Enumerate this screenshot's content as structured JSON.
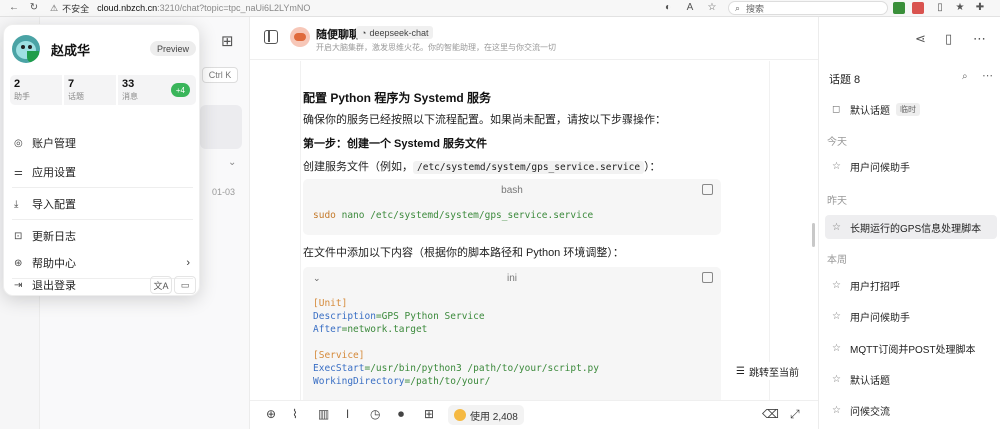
{
  "browser": {
    "insecure_label": "不安全",
    "url_host": "cloud.nbzch.cn",
    "url_path": ":3210/chat?topic=tpc_naUi6L2LYmNO",
    "search_placeholder": "搜索"
  },
  "sessions": {
    "shortcut": "Ctrl K",
    "date": "01-03"
  },
  "profile": {
    "name": "赵成华",
    "badge": "Preview",
    "stats": [
      {
        "num": "2",
        "label": "助手"
      },
      {
        "num": "7",
        "label": "话题"
      },
      {
        "num": "33",
        "label": "消息"
      }
    ],
    "plus": "+4",
    "menu": [
      {
        "label": "账户管理",
        "icon": "user-circle-icon"
      },
      {
        "label": "应用设置",
        "icon": "sliders-icon"
      },
      {
        "label": "导入配置",
        "icon": "import-icon"
      },
      {
        "label": "更新日志",
        "icon": "changelog-icon"
      },
      {
        "label": "帮助中心",
        "icon": "help-icon"
      },
      {
        "label": "退出登录",
        "icon": "logout-icon"
      }
    ]
  },
  "chat": {
    "title": "随便聊聊",
    "model": "deepseek-chat",
    "description": "开启大脑集群，激发思维火花。你的智能助理，在这里与你交流一切",
    "heading": "配置 Python 程序为 Systemd 服务",
    "intro": "确保你的服务已经按照以下流程配置。如果尚未配置，请按以下步骤操作：",
    "step1": "第一步：创建一个 Systemd 服务文件",
    "create_text_prefix": "创建服务文件（例如，",
    "create_path": "/etc/systemd/system/gps_service.service",
    "create_text_suffix": "）：",
    "code1_lang": "bash",
    "code1_cmd": "sudo",
    "code1_rest": " nano /etc/systemd/system/gps_service.service",
    "add_text": "在文件中添加以下内容（根据你的脚本路径和 Python 环境调整）：",
    "code2_lang": "ini",
    "code2_lines": [
      {
        "sec": "[Unit]"
      },
      {
        "key": "Description",
        "val": "=GPS Python Service"
      },
      {
        "key": "After",
        "val": "=network.target"
      },
      {
        "blank": ""
      },
      {
        "sec": "[Service]"
      },
      {
        "key": "ExecStart",
        "val": "=/usr/bin/python3 /path/to/your/script.py"
      },
      {
        "key": "WorkingDirectory",
        "val": "=/path/to/your/"
      }
    ],
    "jump_label": "跳转至当前",
    "usage": "使用 2,408"
  },
  "topics": {
    "title": "话题 8",
    "default_topic": "默认话题",
    "temp_badge": "临时",
    "groups": [
      {
        "label": "今天",
        "items": [
          "用户问候助手"
        ]
      },
      {
        "label": "昨天",
        "items": [
          "长期运行的GPS信息处理脚本"
        ]
      },
      {
        "label": "本周",
        "items": [
          "用户打招呼",
          "用户问候助手",
          "MQTT订阅并POST处理脚本",
          "默认话题",
          "问候交流"
        ]
      }
    ]
  }
}
